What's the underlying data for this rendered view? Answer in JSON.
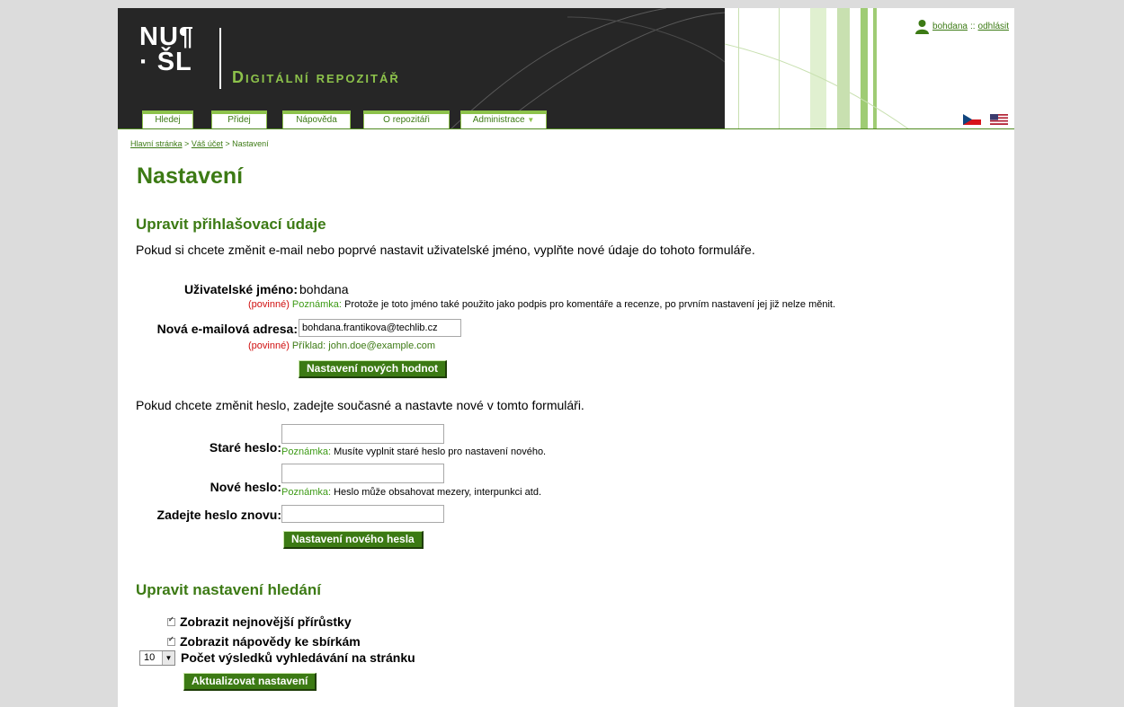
{
  "header": {
    "logo_top": "NU¶",
    "logo_bottom": "· ŠL",
    "repo_title": "Digitální repozitář",
    "nav": [
      {
        "label": "Hledej"
      },
      {
        "label": "Přidej"
      },
      {
        "label": "Nápověda"
      },
      {
        "label": "O repozitáři"
      },
      {
        "label": "Administrace",
        "has_dropdown": true
      }
    ],
    "user": {
      "name": "bohdana",
      "separator": "::",
      "logout": "odhlásit"
    },
    "flags": [
      "czech-flag",
      "us-flag"
    ]
  },
  "breadcrumb": [
    {
      "label": "Hlavní stránka",
      "link": true
    },
    {
      "label": ">",
      "link": false
    },
    {
      "label": "Váš účet",
      "link": true
    },
    {
      "label": ">",
      "link": false
    },
    {
      "label": "Nastavení",
      "link": false
    }
  ],
  "page_title": "Nastavení",
  "login_section": {
    "heading": "Upravit přihlašovací údaje",
    "intro": "Pokud si chcete změnit e-mail nebo poprvé nastavit uživatelské jméno, vyplňte nové údaje do tohoto formuláře.",
    "username_label": "Uživatelské jméno:",
    "username_value": "bohdana",
    "required": "(povinné)",
    "note_key": "Poznámka:",
    "username_note": "Protože je toto jméno také použito jako podpis pro komentáře a recenze, po prvním nastavení jej již nelze měnit.",
    "email_label": "Nová e-mailová adresa:",
    "email_value": "bohdana.frantikova@techlib.cz",
    "email_example": "Příklad: john.doe@example.com",
    "submit": "Nastavení nových hodnot"
  },
  "password_section": {
    "intro": "Pokud chcete změnit heslo, zadejte současné a nastavte nové v tomto formuláři.",
    "old_label": "Staré heslo:",
    "old_note": "Musíte vyplnit staré heslo pro nastavení nového.",
    "new_label": "Nové heslo:",
    "new_note": "Heslo může obsahovat mezery, interpunkci atd.",
    "repeat_label": "Zadejte heslo znovu:",
    "submit": "Nastavení nového hesla"
  },
  "search_section": {
    "heading": "Upravit nastavení hledání",
    "show_newest": "Zobrazit nejnovější přírůstky",
    "show_help": "Zobrazit nápovědy ke sbírkám",
    "results_value": "10",
    "results_label": "Počet výsledků vyhledávání na stránku",
    "submit": "Aktualizovat nastavení"
  },
  "colors": {
    "brand_green": "#3c7a14",
    "light_green": "#8dc24b",
    "header_dark": "#262626",
    "required_red": "#d01010"
  }
}
